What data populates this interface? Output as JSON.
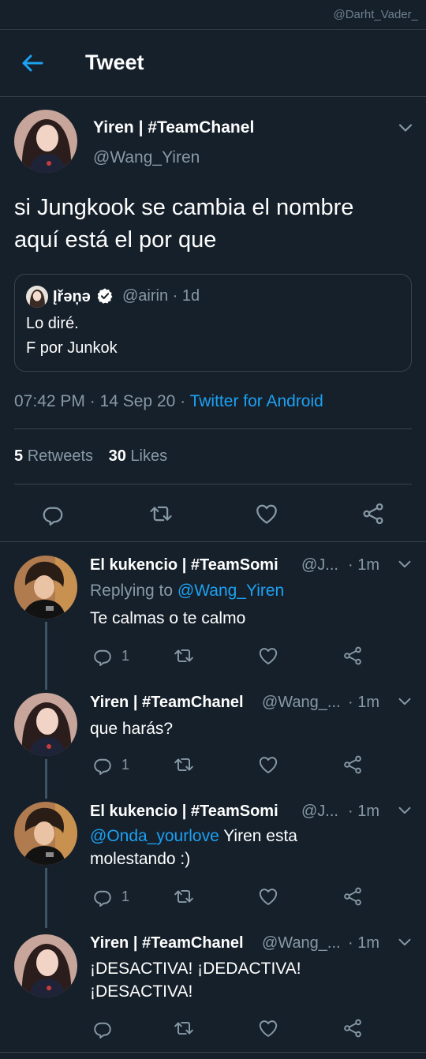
{
  "watermark": "@Darht_Vader_",
  "header": {
    "title": "Tweet"
  },
  "tweet": {
    "name": "Yiren | #TeamChanel",
    "handle": "@Wang_Yiren",
    "text_line1": "si Jungkook se cambia el nombre",
    "text_line2": "aquí está el por que",
    "quote": {
      "name": "Įřəņə",
      "handle": "@airin · 1d",
      "line1": "Lo diré.",
      "line2": "F por Junkok"
    },
    "time": "07:42 PM · 14 Sep 20 · ",
    "source": "Twitter for Android",
    "retweets_count": "5",
    "retweets_label": "Retweets",
    "likes_count": "30",
    "likes_label": "Likes"
  },
  "replies": [
    {
      "name": "El kukencio | #TeamSomi",
      "handle": "@J...",
      "time": "· 1m",
      "replying_prefix": "Replying to ",
      "replying_to": "@Wang_Yiren",
      "text": "Te calmas o te calmo",
      "reply_count": "1"
    },
    {
      "name": "Yiren | #TeamChanel",
      "handle": "@Wang_...",
      "time": "· 1m",
      "text": "que harás?",
      "reply_count": "1"
    },
    {
      "name": "El kukencio | #TeamSomi",
      "handle": "@J...",
      "time": "· 1m",
      "mention": "@Onda_yourlove",
      "text_rest": " Yiren esta",
      "text_line2": "molestando :)",
      "reply_count": "1"
    },
    {
      "name": "Yiren | #TeamChanel",
      "handle": "@Wang_...",
      "time": "· 1m",
      "text_line1": "¡DESACTIVA! ¡DEDACTIVA!",
      "text_line2": "¡DESACTIVA!"
    }
  ],
  "colors": {
    "background": "#15202b",
    "accent": "#1da1f2",
    "secondary": "#8899a6",
    "border": "#38444d"
  },
  "icons": [
    "back-arrow-icon",
    "chevron-down-icon",
    "verified-badge-icon",
    "reply-icon",
    "retweet-icon",
    "like-icon",
    "share-icon"
  ]
}
